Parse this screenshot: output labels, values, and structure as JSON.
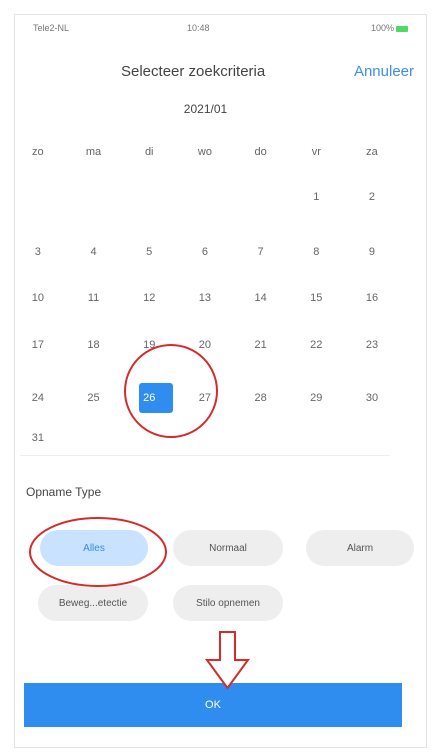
{
  "status": {
    "left": "Tele2-NL",
    "time": "10:48",
    "right": "100%"
  },
  "header": {
    "title": "Selecteer zoekcriteria",
    "cancel": "Annuleer"
  },
  "calendar": {
    "month": "2021/01",
    "weekdays": [
      "zo",
      "ma",
      "di",
      "wo",
      "do",
      "vr",
      "za"
    ],
    "weeks": [
      [
        "",
        "",
        "",
        "",
        "",
        "1",
        "2"
      ],
      [
        "3",
        "4",
        "5",
        "6",
        "7",
        "8",
        "9"
      ],
      [
        "10",
        "11",
        "12",
        "13",
        "14",
        "15",
        "16"
      ],
      [
        "17",
        "18",
        "19",
        "20",
        "21",
        "22",
        "23"
      ],
      [
        "24",
        "25",
        "26",
        "27",
        "28",
        "29",
        "30"
      ],
      [
        "31",
        "",
        "",
        "",
        "",
        "",
        ""
      ]
    ],
    "selected": "26"
  },
  "section": {
    "title": "Opname Type"
  },
  "types": [
    {
      "label": "Alles",
      "active": true
    },
    {
      "label": "Normaal",
      "active": false
    },
    {
      "label": "Alarm",
      "active": false
    },
    {
      "label": "Beweg...etectie",
      "active": false
    },
    {
      "label": "Stilo opnemen",
      "active": false
    }
  ],
  "ok": "OK",
  "colors": {
    "accent": "#2f8df0",
    "annotation": "#d42b2b"
  }
}
